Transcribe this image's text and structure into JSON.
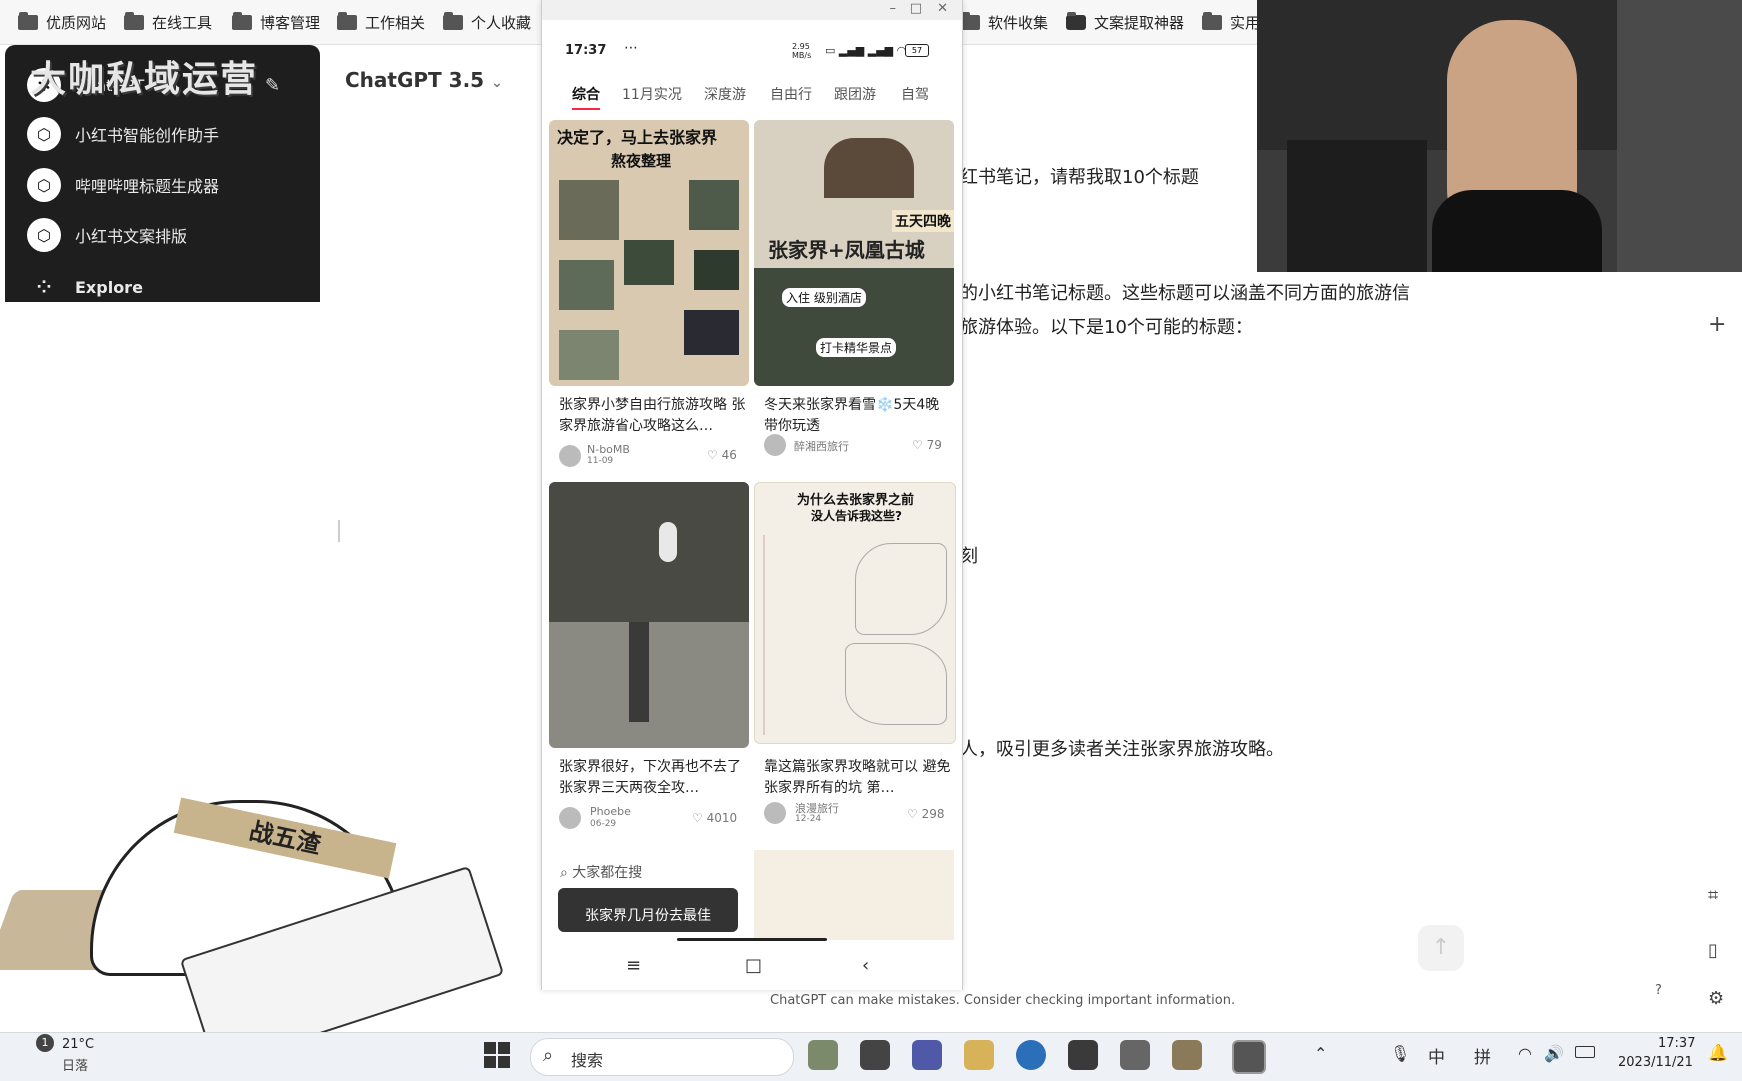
{
  "bookmarks": [
    {
      "label": "优质网站"
    },
    {
      "label": "在线工具"
    },
    {
      "label": "博客管理"
    },
    {
      "label": "工作相关"
    },
    {
      "label": "个人收藏"
    },
    {
      "label": "软件收集"
    },
    {
      "label": "文案提取神器"
    },
    {
      "label": "实用"
    }
  ],
  "watermark": "大咖私域运营",
  "sidebar": {
    "items": [
      {
        "label": "ChatGPT"
      },
      {
        "label": "小红书智能创作助手"
      },
      {
        "label": "哔哩哔哩标题生成器"
      },
      {
        "label": "小红书文案排版"
      },
      {
        "label": "Explore"
      }
    ]
  },
  "header": {
    "model": "ChatGPT 3.5"
  },
  "phone": {
    "status": {
      "time": "17:37",
      "net": "2.95 MB/s",
      "battery": "57"
    },
    "tabs": [
      {
        "label": "综合"
      },
      {
        "label": "11月实况"
      },
      {
        "label": "深度游"
      },
      {
        "label": "自由行"
      },
      {
        "label": "跟团游"
      },
      {
        "label": "自驾"
      }
    ],
    "cards": [
      {
        "img_title": "决定了，马上去张家界",
        "img_sub": "熬夜整理",
        "caption": "张家界小梦自由行旅游攻略 张家界旅游省心攻略这么…",
        "author": "N-boMB",
        "date": "11-09",
        "likes": "46"
      },
      {
        "img_title": "张家界+凤凰古城",
        "img_sub": "五天四晚",
        "img_tag1": "入住 级别酒店",
        "img_tag2": "打卡精华景点",
        "caption": "冬天来张家界看雪❄️5天4晚 带你玩透",
        "author": "醉湘西旅行",
        "date": "",
        "likes": "79"
      },
      {
        "caption": "张家界很好，下次再也不去了 张家界三天两夜全攻…",
        "author": "Phoebe",
        "date": "06-29",
        "likes": "4010"
      },
      {
        "img_title": "为什么去张家界之前",
        "img_sub": "没人告诉我这些?",
        "caption": "靠这篇张家界攻略就可以 避免张家界所有的坑 第…",
        "author": "浪漫旅行",
        "date": "12-24",
        "likes": "298"
      }
    ],
    "search_hint": "大家都在搜",
    "banner": "张家界几月份去最佳"
  },
  "right": {
    "line1": "红书笔记，请帮我取10个标题",
    "line2": "的小红书笔记标题。这些标题可以涵盖不同方面的旅游信",
    "line3": "旅游体验。以下是10个可能的标题：",
    "frag1": "刻",
    "line_final": "人，吸引更多读者关注张家界旅游攻略。",
    "disclaimer": "ChatGPT can make mistakes. Consider checking important information.",
    "help": "?",
    "plus": "+"
  },
  "sticker": {
    "headband": "战五渣"
  },
  "taskbar": {
    "temp": "21°C",
    "weather": "日落",
    "badge": "1",
    "search": "搜索",
    "ime1": "中",
    "ime2": "拼",
    "time": "17:37",
    "date": "2023/11/21"
  }
}
